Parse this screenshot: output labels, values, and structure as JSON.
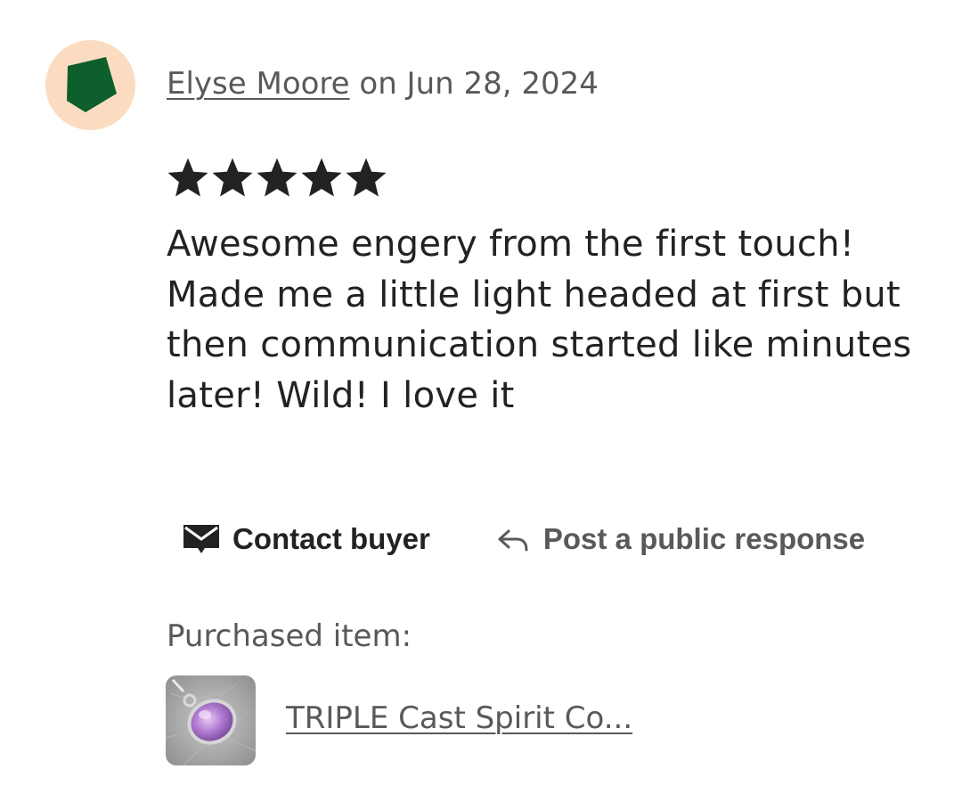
{
  "review": {
    "reviewer_name": "Elyse Moore",
    "date_text": "on Jun 28, 2024",
    "rating": 5,
    "rating_max": 5,
    "text": "Awesome engery from the first touch! Made me a little light headed at first but then communication started like minutes later! Wild! I love it"
  },
  "avatar": {
    "icon": "pentagon-avatar-icon",
    "background_color": "#fbdcc0",
    "shape_color": "#0d5f2c"
  },
  "actions": {
    "contact_label": "Contact buyer",
    "contact_icon": "envelope-icon",
    "respond_label": "Post a public response",
    "respond_icon": "reply-arrow-icon"
  },
  "purchase": {
    "label": "Purchased item:",
    "item_title": "TRIPLE Cast Spirit Co...",
    "thumbnail": "amethyst-pendant-image"
  },
  "colors": {
    "text_primary": "#222222",
    "text_secondary": "#595959",
    "star": "#222222"
  }
}
